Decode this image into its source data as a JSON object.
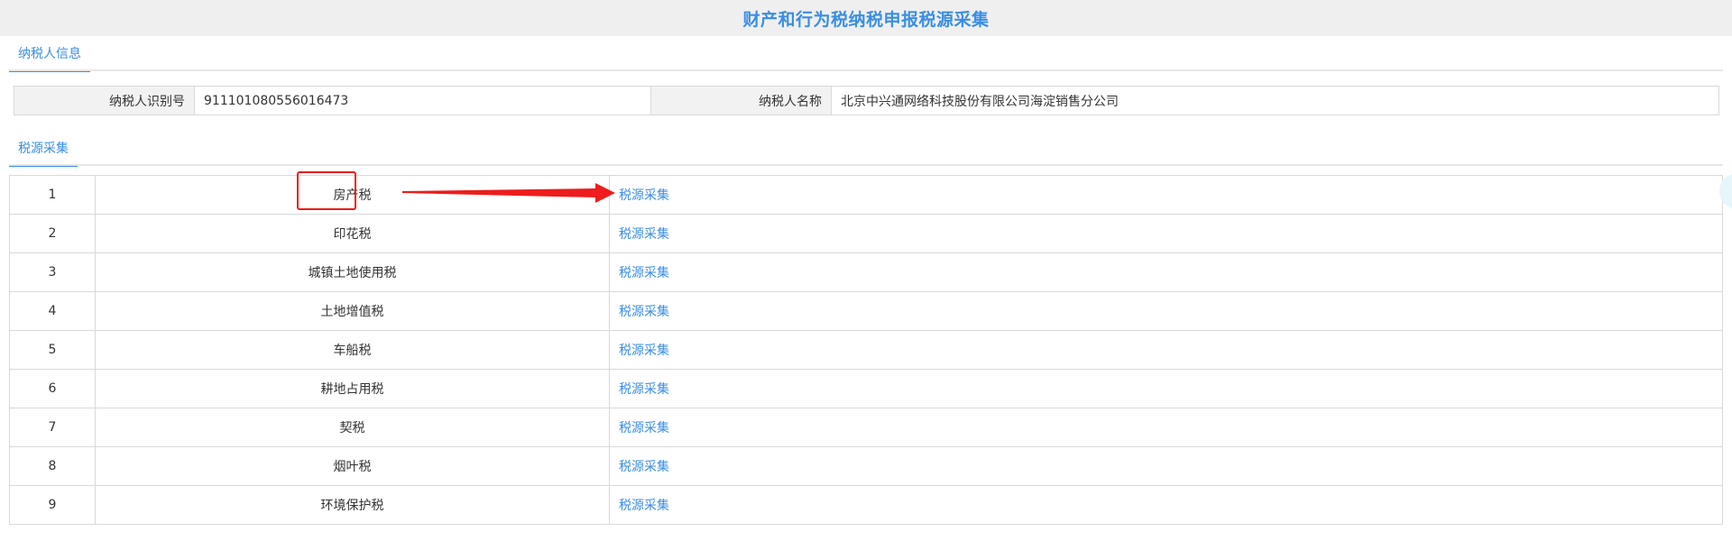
{
  "page": {
    "title": "财产和行为税纳税申报税源采集"
  },
  "taxpayer_section": {
    "tab_label": "纳税人信息",
    "id_label": "纳税人识别号",
    "id_value": "911101080556016473",
    "name_label": "纳税人名称",
    "name_value": "北京中兴通网络科技股份有限公司海淀销售分公司"
  },
  "source_section": {
    "tab_label": "税源采集",
    "rows": [
      {
        "no": "1",
        "tax": "房产税",
        "action": "税源采集"
      },
      {
        "no": "2",
        "tax": "印花税",
        "action": "税源采集"
      },
      {
        "no": "3",
        "tax": "城镇土地使用税",
        "action": "税源采集"
      },
      {
        "no": "4",
        "tax": "土地增值税",
        "action": "税源采集"
      },
      {
        "no": "5",
        "tax": "车船税",
        "action": "税源采集"
      },
      {
        "no": "6",
        "tax": "耕地占用税",
        "action": "税源采集"
      },
      {
        "no": "7",
        "tax": "契税",
        "action": "税源采集"
      },
      {
        "no": "8",
        "tax": "烟叶税",
        "action": "税源采集"
      },
      {
        "no": "9",
        "tax": "环境保护税",
        "action": "税源采集"
      }
    ]
  },
  "colors": {
    "accent": "#3a8ee6",
    "annotation": "#ee1c1c",
    "header_bg": "#efefef",
    "border": "#d9d9d9"
  }
}
